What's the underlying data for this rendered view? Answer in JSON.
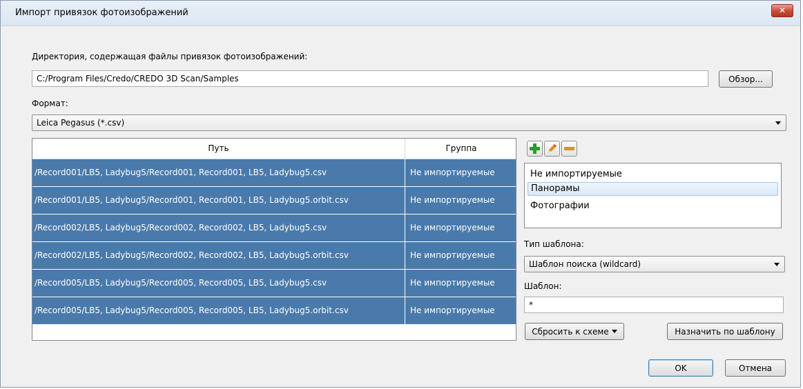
{
  "window": {
    "title": "Импорт привязок фотоизображений",
    "close_label": "✕"
  },
  "directory": {
    "label": "Директория, содержащая файлы привязок фотоизображений:",
    "value": "C:/Program Files/Credo/CREDO 3D Scan/Samples",
    "browse_label": "Обзор..."
  },
  "format": {
    "label": "Формат:",
    "value": "Leica Pegasus (*.csv)"
  },
  "table": {
    "columns": [
      "Путь",
      "Группа"
    ],
    "rows": [
      {
        "path": "/Record001/LB5, Ladybug5/Record001, Record001, LB5, Ladybug5.csv",
        "group": "Не импортируемые"
      },
      {
        "path": "/Record001/LB5, Ladybug5/Record001, Record001, LB5, Ladybug5.orbit.csv",
        "group": "Не импортируемые"
      },
      {
        "path": "/Record002/LB5, Ladybug5/Record002, Record002, LB5, Ladybug5.csv",
        "group": "Не импортируемые"
      },
      {
        "path": "/Record002/LB5, Ladybug5/Record002, Record002, LB5, Ladybug5.orbit.csv",
        "group": "Не импортируемые"
      },
      {
        "path": "/Record005/LB5, Ladybug5/Record005, Record005, LB5, Ladybug5.csv",
        "group": "Не импортируемые"
      },
      {
        "path": "/Record005/LB5, Ladybug5/Record005, Record005, LB5, Ladybug5.orbit.csv",
        "group": "Не импортируемые"
      }
    ]
  },
  "groups": {
    "toolbar_icons": [
      "plus-icon",
      "pencil-icon",
      "minus-icon"
    ],
    "items": [
      "Не импортируемые",
      "Панорамы",
      "Фотографии"
    ],
    "selected": "Панорамы"
  },
  "template_type": {
    "label": "Тип шаблона:",
    "value": "Шаблон поиска (wildcard)"
  },
  "template": {
    "label": "Шаблон:",
    "value": "*"
  },
  "actions": {
    "reset_label": "Сбросить к схеме",
    "assign_label": "Назначить по шаблону",
    "ok_label": "OK",
    "cancel_label": "Отмена"
  },
  "colors": {
    "row_selected": "#4a7aab",
    "add_green": "#2e9a2e",
    "edit_orange": "#e08a1e",
    "remove_orange": "#e0921e"
  }
}
